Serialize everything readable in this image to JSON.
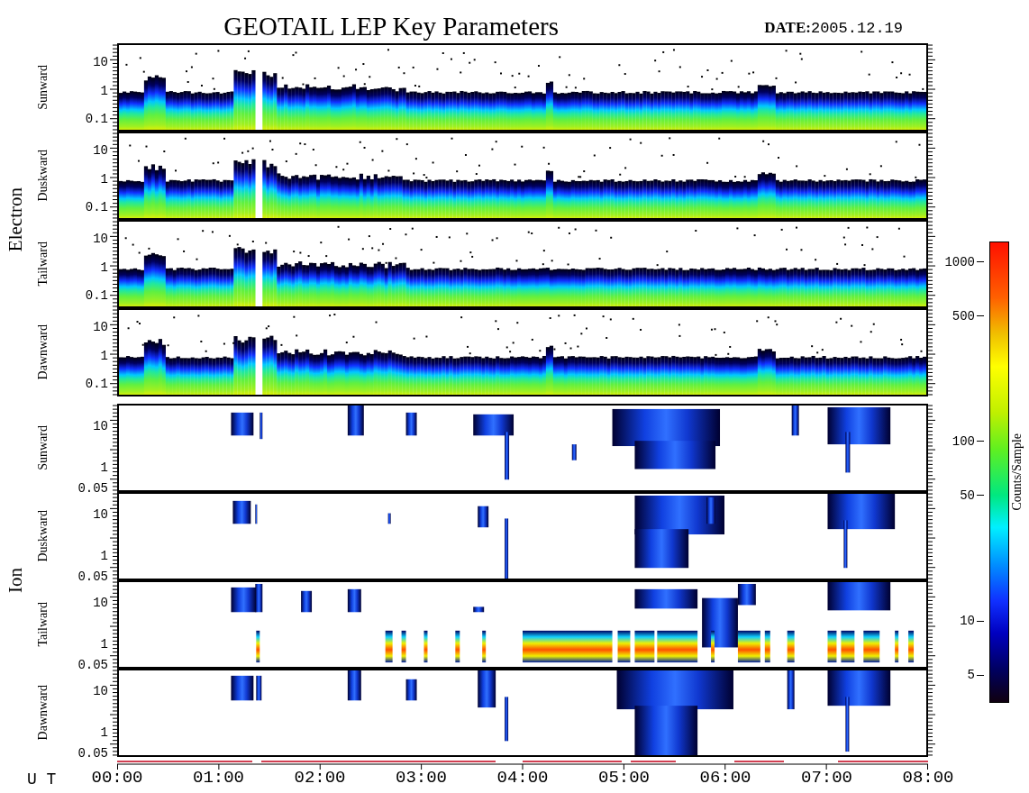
{
  "title": "GEOTAIL LEP Key Parameters",
  "date": {
    "label": "DATE:",
    "value": "2005.12.19"
  },
  "groups": [
    {
      "name": "Electron",
      "kind": "electron",
      "panels": [
        {
          "label": "Sunward",
          "yticks": [
            "10",
            "1",
            "0.1"
          ]
        },
        {
          "label": "Duskward",
          "yticks": [
            "10",
            "1",
            "0.1"
          ]
        },
        {
          "label": "Tailward",
          "yticks": [
            "10",
            "1",
            "0.1"
          ]
        },
        {
          "label": "Dawnward",
          "yticks": [
            "10",
            "1",
            "0.1"
          ]
        }
      ]
    },
    {
      "name": "Ion",
      "kind": "ion",
      "panels": [
        {
          "label": "Sunward",
          "yticks": [
            "10",
            "1",
            "0.05"
          ]
        },
        {
          "label": "Duskward",
          "yticks": [
            "10",
            "1",
            "0.05"
          ]
        },
        {
          "label": "Tailward",
          "yticks": [
            "10",
            "1",
            "0.05"
          ]
        },
        {
          "label": "Dawnward",
          "yticks": [
            "10",
            "1",
            "0.05"
          ]
        }
      ]
    }
  ],
  "colorbar": {
    "label": "Counts/Sample",
    "ticks": [
      "1000",
      "500",
      "100",
      "50",
      "10",
      "5"
    ]
  },
  "time_axis": {
    "label": "U T",
    "ticks": [
      "00:00",
      "01:00",
      "02:00",
      "03:00",
      "04:00",
      "05:00",
      "06:00",
      "07:00",
      "08:00"
    ]
  }
}
